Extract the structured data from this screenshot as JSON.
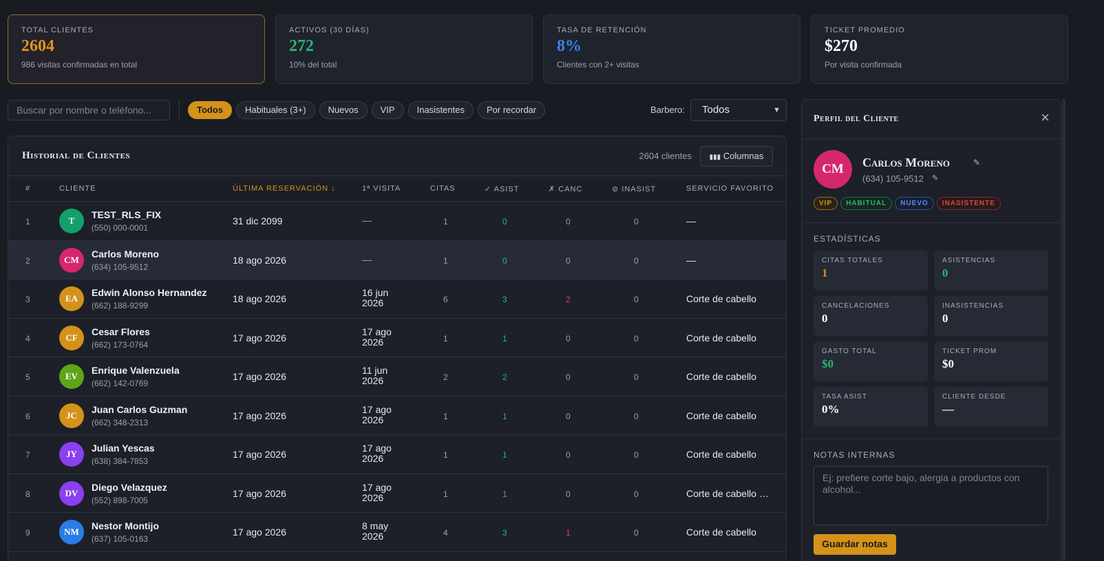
{
  "kpis": [
    {
      "label": "Total Clientes",
      "value": "2604",
      "sub": "986 visitas confirmadas en total",
      "color": "#e0951c"
    },
    {
      "label": "Activos (30 días)",
      "value": "272",
      "sub": "10% del total",
      "color": "#2bb673"
    },
    {
      "label": "Tasa de Retención",
      "value": "8%",
      "sub": "Clientes con 2+ visitas",
      "color": "#3b82f6"
    },
    {
      "label": "Ticket Promedio",
      "value": "$270",
      "sub": "Por visita confirmada",
      "color": "#ffffff"
    }
  ],
  "search": {
    "placeholder": "Buscar por nombre o teléfono..."
  },
  "filters": [
    "Todos",
    "Habituales (3+)",
    "Nuevos",
    "VIP",
    "Inasistentes",
    "Por recordar"
  ],
  "barbero": {
    "label": "Barbero:",
    "value": "Todos"
  },
  "table": {
    "title": "Historial de Clientes",
    "count": "2604 clientes",
    "columns_button": "Columnas",
    "headers": [
      "#",
      "Cliente",
      "Última reservación ↓",
      "1ª visita",
      "Citas",
      "✓ Asist",
      "✗ Canc",
      "⊘ Inasist",
      "Servicio favorito"
    ],
    "rows": [
      {
        "num": "1",
        "initials": "T",
        "color": "#13a06a",
        "name": "TEST_RLS_FIX",
        "phone": "(550) 000-0001",
        "last": "31 dic 2099",
        "first": "—",
        "citas": "1",
        "asist": "0",
        "canc": "0",
        "inasist": "0",
        "serv": "—"
      },
      {
        "num": "2",
        "initials": "CM",
        "color": "#d6266e",
        "name": "Carlos Moreno",
        "phone": "(634) 105-9512",
        "last": "18 ago 2026",
        "first": "—",
        "citas": "1",
        "asist": "0",
        "canc": "0",
        "inasist": "0",
        "serv": "—"
      },
      {
        "num": "3",
        "initials": "EA",
        "color": "#d4921a",
        "name": "Edwin Alonso Hernandez",
        "phone": "(662) 188-9299",
        "last": "18 ago 2026",
        "first": "16 jun 2026",
        "citas": "6",
        "asist": "3",
        "canc": "2",
        "inasist": "0",
        "serv": "Corte de cabello"
      },
      {
        "num": "4",
        "initials": "CF",
        "color": "#d4921a",
        "name": "Cesar Flores",
        "phone": "(662) 173-0764",
        "last": "17 ago 2026",
        "first": "17 ago 2026",
        "citas": "1",
        "asist": "1",
        "canc": "0",
        "inasist": "0",
        "serv": "Corte de cabello"
      },
      {
        "num": "5",
        "initials": "EV",
        "color": "#5ea51a",
        "name": "Enrique Valenzuela",
        "phone": "(662) 142-0769",
        "last": "17 ago 2026",
        "first": "11 jun 2026",
        "citas": "2",
        "asist": "2",
        "canc": "0",
        "inasist": "0",
        "serv": "Corte de cabello"
      },
      {
        "num": "6",
        "initials": "JC",
        "color": "#d4921a",
        "name": "Juan Carlos Guzman",
        "phone": "(662) 348-2313",
        "last": "17 ago 2026",
        "first": "17 ago 2026",
        "citas": "1",
        "asist": "1",
        "canc": "0",
        "inasist": "0",
        "serv": "Corte de cabello"
      },
      {
        "num": "7",
        "initials": "JY",
        "color": "#8b3ff0",
        "name": "Julian Yescas",
        "phone": "(638) 384-7853",
        "last": "17 ago 2026",
        "first": "17 ago 2026",
        "citas": "1",
        "asist": "1",
        "canc": "0",
        "inasist": "0",
        "serv": "Corte de cabello"
      },
      {
        "num": "8",
        "initials": "DV",
        "color": "#8b3ff0",
        "name": "Diego Velazquez",
        "phone": "(552) 898-7005",
        "last": "17 ago 2026",
        "first": "17 ago 2026",
        "citas": "1",
        "asist": "1",
        "canc": "0",
        "inasist": "0",
        "serv": "Corte de cabello y ..."
      },
      {
        "num": "9",
        "initials": "NM",
        "color": "#2b7be8",
        "name": "Nestor Montijo",
        "phone": "(637) 105-0163",
        "last": "17 ago 2026",
        "first": "8 may 2026",
        "citas": "4",
        "asist": "3",
        "canc": "1",
        "inasist": "0",
        "serv": "Corte de cabello"
      }
    ]
  },
  "profile": {
    "title": "Perfil del Cliente",
    "close_icon": "×",
    "initials": "CM",
    "name": "Carlos Moreno",
    "phone": "(634) 105-9512",
    "tags": [
      "VIP",
      "HABITUAL",
      "NUEVO",
      "INASISTENTE"
    ],
    "stats_label": "Estadísticas",
    "stats": [
      {
        "label": "Citas totales",
        "value": "1",
        "color": "#d4921a"
      },
      {
        "label": "Asistencias",
        "value": "0",
        "color": "#2bb673"
      },
      {
        "label": "Cancelaciones",
        "value": "0",
        "color": "#ffffff"
      },
      {
        "label": "Inasistencias",
        "value": "0",
        "color": "#ffffff"
      },
      {
        "label": "Gasto total",
        "value": "$0",
        "color": "#2bb673"
      },
      {
        "label": "Ticket prom",
        "value": "$0",
        "color": "#ffffff"
      },
      {
        "label": "Tasa asist",
        "value": "0%",
        "color": "#ffffff"
      },
      {
        "label": "Cliente desde",
        "value": "—",
        "color": "#ffffff"
      }
    ],
    "notes_label": "Notas internas",
    "notes_placeholder": "Ej: prefiere corte bajo, alergia a productos con alcohol...",
    "save_label": "Guardar notas"
  }
}
